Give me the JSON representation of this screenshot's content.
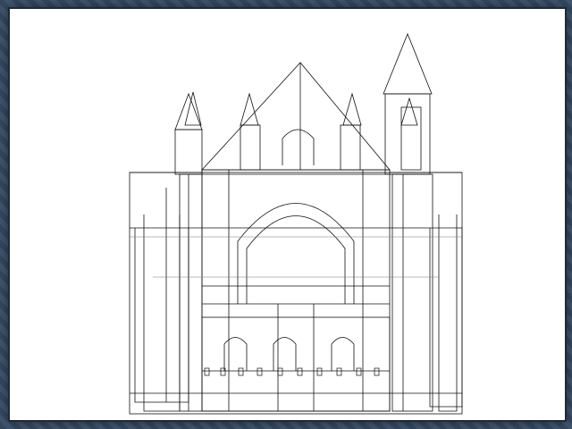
{
  "viewport": {
    "background": "#ffffff",
    "frame_color": "#3d5068",
    "line_color": "#000000",
    "subject": "cathedral-facade-wireframe"
  }
}
